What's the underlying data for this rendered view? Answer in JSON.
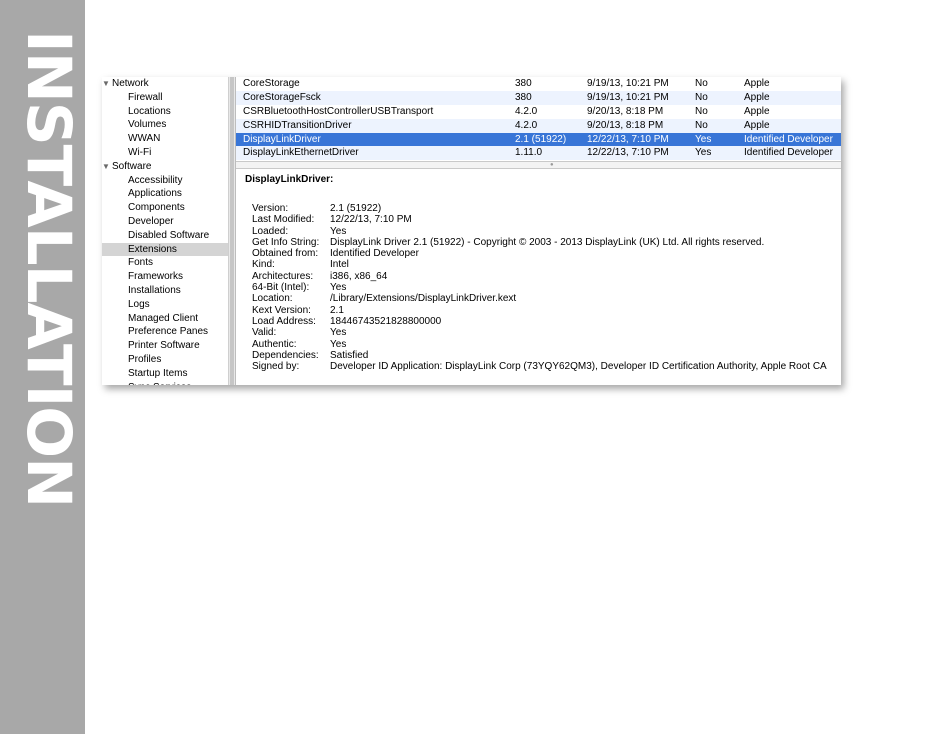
{
  "page": {
    "band_title": "INSTALLATION"
  },
  "sidebar": {
    "items": [
      {
        "label": "Network",
        "group": true,
        "expanded": true
      },
      {
        "label": "Firewall"
      },
      {
        "label": "Locations"
      },
      {
        "label": "Volumes"
      },
      {
        "label": "WWAN"
      },
      {
        "label": "Wi-Fi"
      },
      {
        "label": "Software",
        "group": true,
        "expanded": true
      },
      {
        "label": "Accessibility"
      },
      {
        "label": "Applications"
      },
      {
        "label": "Components"
      },
      {
        "label": "Developer"
      },
      {
        "label": "Disabled Software"
      },
      {
        "label": "Extensions",
        "selected": true
      },
      {
        "label": "Fonts"
      },
      {
        "label": "Frameworks"
      },
      {
        "label": "Installations"
      },
      {
        "label": "Logs"
      },
      {
        "label": "Managed Client"
      },
      {
        "label": "Preference Panes"
      },
      {
        "label": "Printer Software"
      },
      {
        "label": "Profiles"
      },
      {
        "label": "Startup Items"
      },
      {
        "label": "Sync Services"
      }
    ],
    "expand_glyph": "▼"
  },
  "extensions_table": {
    "rows": [
      {
        "name": "CoreStorage",
        "version": "380",
        "modified": "9/19/13, 10:21 PM",
        "loaded": "No",
        "obtained_from": "Apple"
      },
      {
        "name": "CoreStorageFsck",
        "version": "380",
        "modified": "9/19/13, 10:21 PM",
        "loaded": "No",
        "obtained_from": "Apple"
      },
      {
        "name": "CSRBluetoothHostControllerUSBTransport",
        "version": "4.2.0",
        "modified": "9/20/13, 8:18 PM",
        "loaded": "No",
        "obtained_from": "Apple"
      },
      {
        "name": "CSRHIDTransitionDriver",
        "version": "4.2.0",
        "modified": "9/20/13, 8:18 PM",
        "loaded": "No",
        "obtained_from": "Apple"
      },
      {
        "name": "DisplayLinkDriver",
        "version": "2.1 (51922)",
        "modified": "12/22/13, 7:10 PM",
        "loaded": "Yes",
        "obtained_from": "Identified Developer",
        "selected": true
      },
      {
        "name": "DisplayLinkEthernetDriver",
        "version": "1.11.0",
        "modified": "12/22/13, 7:10 PM",
        "loaded": "Yes",
        "obtained_from": "Identified Developer"
      }
    ]
  },
  "detail": {
    "title": "DisplayLinkDriver:",
    "fields": [
      {
        "key": "Version:",
        "value": "2.1 (51922)"
      },
      {
        "key": "Last Modified:",
        "value": "12/22/13, 7:10 PM"
      },
      {
        "key": "Loaded:",
        "value": "Yes"
      },
      {
        "key": "Get Info String:",
        "value": "DisplayLink Driver 2.1 (51922) - Copyright © 2003 - 2013 DisplayLink (UK) Ltd. All rights reserved."
      },
      {
        "key": "Obtained from:",
        "value": "Identified Developer"
      },
      {
        "key": "Kind:",
        "value": "Intel"
      },
      {
        "key": "Architectures:",
        "value": "i386, x86_64"
      },
      {
        "key": "64-Bit (Intel):",
        "value": "Yes"
      },
      {
        "key": "Location:",
        "value": "/Library/Extensions/DisplayLinkDriver.kext"
      },
      {
        "key": "Kext Version:",
        "value": "2.1"
      },
      {
        "key": "Load Address:",
        "value": "18446743521828800000"
      },
      {
        "key": "Valid:",
        "value": "Yes"
      },
      {
        "key": "Authentic:",
        "value": "Yes"
      },
      {
        "key": "Dependencies:",
        "value": "Satisfied"
      },
      {
        "key": "Signed by:",
        "value": "Developer ID Application: DisplayLink Corp (73YQY62QM3), Developer ID Certification Authority, Apple Root CA"
      }
    ]
  },
  "colors": {
    "band": "#a8a8a8",
    "selection": "#3875d7",
    "alt_row": "#edf3fe",
    "sidebar_selection": "#d4d4d4"
  }
}
